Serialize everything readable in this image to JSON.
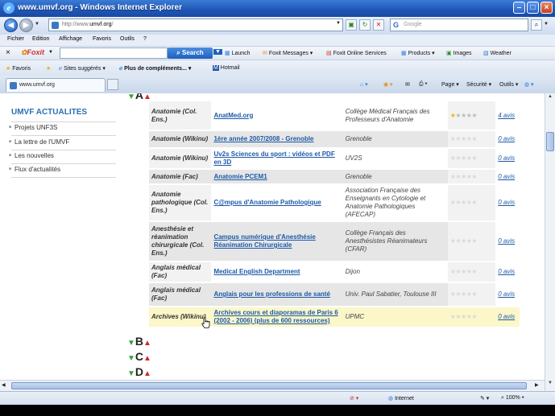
{
  "window": {
    "title": "www.umvf.org - Windows Internet Explorer"
  },
  "address_bar": {
    "url_prefix": "http://www.",
    "url_domain": "umvf.org",
    "url_suffix": "/",
    "search_placeholder": "Google"
  },
  "menu": [
    "Fichier",
    "Edition",
    "Affichage",
    "Favoris",
    "Outils",
    "?"
  ],
  "foxit_toolbar": {
    "brand": "Foxit",
    "search_button": "Search",
    "items": [
      "Launch",
      "Foxit Messages",
      "Foxit Online Services",
      "Products",
      "Images",
      "Weather"
    ]
  },
  "favorites_bar": {
    "favorites_label": "Favoris",
    "items": [
      "Sites suggérés",
      "Plus de compléments...",
      "Hotmail"
    ]
  },
  "tab": {
    "label": "www.umvf.org"
  },
  "command_bar": {
    "page": "Page",
    "security": "Sécurité",
    "tools": "Outils"
  },
  "sidebar": {
    "title": "UMVF ACTUALITES",
    "items": [
      "Projets UNF3S",
      "La lettre de l'UMVF",
      "Les nouvelles",
      "Flux d'actualités"
    ]
  },
  "directory": {
    "top_letter": "A",
    "rows": [
      {
        "category": "Anatomie (Col. Ens.)",
        "name": "AnatMed.org",
        "org": "Collège Médical Français des Professeurs d'Anatomie",
        "rating": 1,
        "reviews": "4 avis"
      },
      {
        "category": "Anatomie (Wikinu)",
        "name": "1ère année 2007/2008 - Grenoble",
        "org": "Grenoble",
        "rating": 0,
        "reviews": "0 avis"
      },
      {
        "category": "Anatomie (Wikinu)",
        "name": "Uv2s Sciences du sport : vidéos et PDF en 3D",
        "org": "UV2S",
        "rating": 0,
        "reviews": "0 avis"
      },
      {
        "category": "Anatomie (Fac)",
        "name": "Anatomie PCEM1",
        "org": "Grenoble",
        "rating": 0,
        "reviews": "0 avis"
      },
      {
        "category": "Anatomie pathologique (Col. Ens.)",
        "name": "C@mpus d'Anatomie Pathologique",
        "org": "Association Française des Enseignants en Cytologie et Anatomie Pathologiques (AFECAP)",
        "rating": 0,
        "reviews": "0 avis"
      },
      {
        "category": "Anesthésie et réanimation chirurgicale (Col. Ens.)",
        "name": "Campus numérique d'Anesthésie Réanimation Chirurgicale",
        "org": "Collège Français des Anesthésistes Réanimateurs (CFAR)",
        "rating": 0,
        "reviews": "0 avis"
      },
      {
        "category": "Anglais médical (Fac)",
        "name": "Medical English Department",
        "org": "Dijon",
        "rating": 0,
        "reviews": "0 avis"
      },
      {
        "category": "Anglais médical (Fac)",
        "name": "Anglais pour les professions de santé",
        "org": "Univ. Paul Sabatier, Toulouse III",
        "rating": 0,
        "reviews": "0 avis"
      },
      {
        "category": "Archives (Wikinu)",
        "name": "Archives cours et diaporamas de Paris 6 (2002 - 2006) (plus de 600 ressources)",
        "org": "UPMC",
        "rating": 0,
        "reviews": "0 avis"
      }
    ],
    "letters": [
      "B",
      "C",
      "D"
    ]
  },
  "statusbar": {
    "zone": "Internet",
    "zoom": "100%"
  },
  "colors": {
    "link": "#1d5aa8",
    "sidebar_title": "#2a6fb4",
    "highlight_row": "#fbf7c9",
    "star": "#f4b400"
  }
}
